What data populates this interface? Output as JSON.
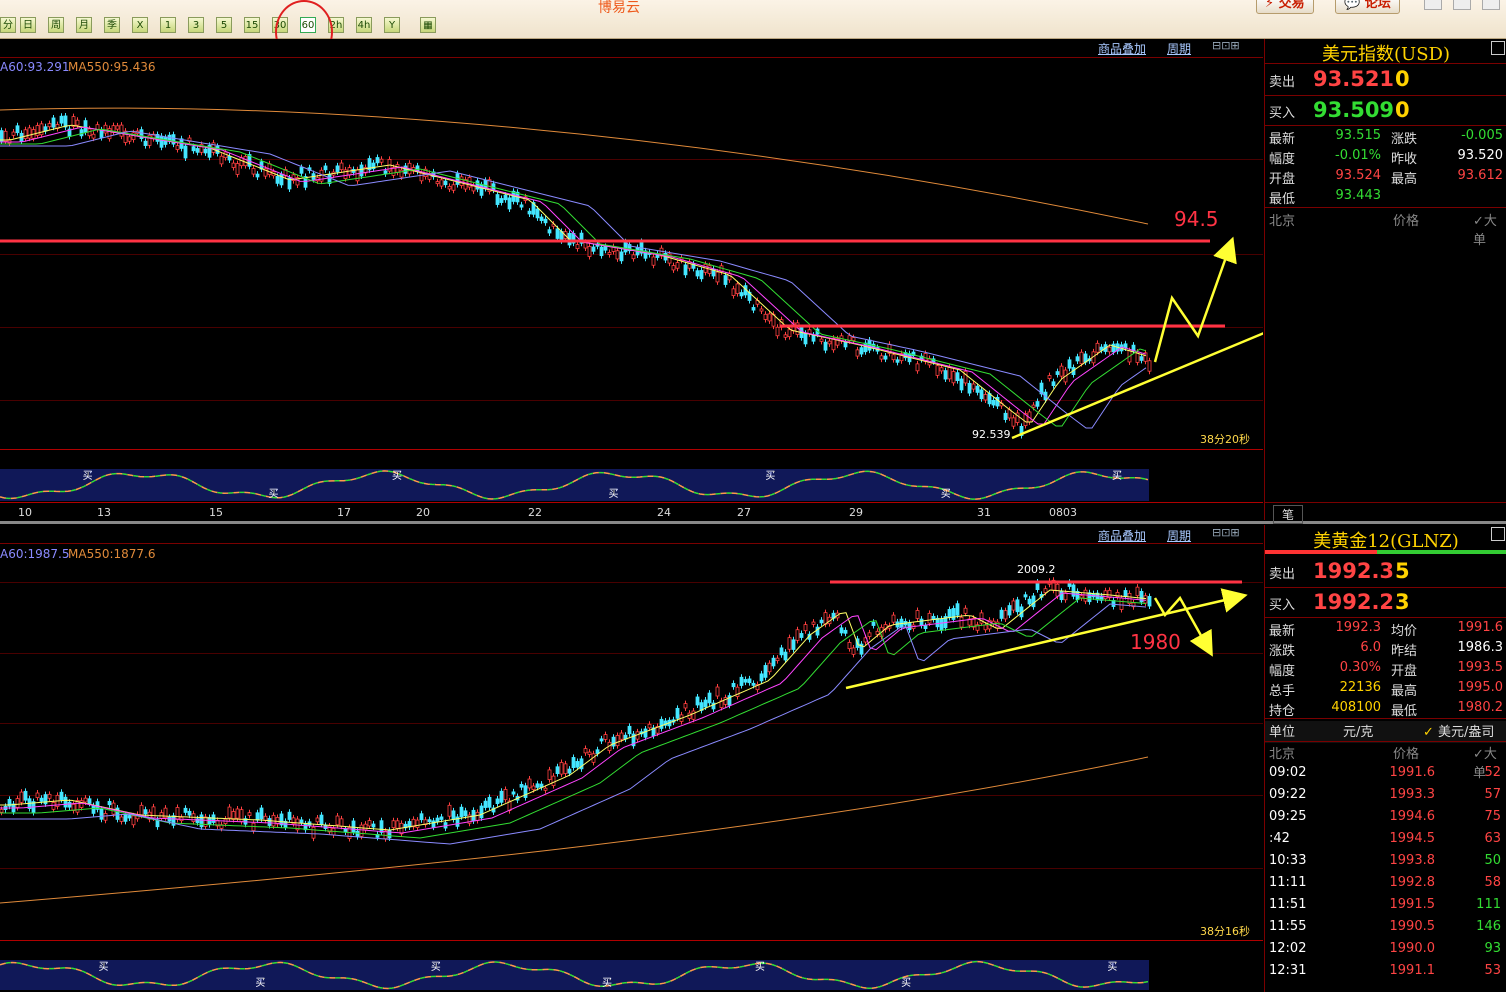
{
  "app_title": "博易云",
  "toolbar": {
    "period_buttons": [
      "分",
      "日",
      "周",
      "月",
      "季",
      "X",
      "1",
      "3",
      "5",
      "15",
      "30",
      "60",
      "2hr",
      "4hr",
      "Y",
      "▦"
    ],
    "active_period": "60",
    "trade_label": "交易",
    "forum_label": "论坛"
  },
  "top_chart": {
    "ma_labels": [
      {
        "text": "A60:93.291",
        "color": "#8a8aff"
      },
      {
        "text": "MA550:95.436",
        "color": "#e08a3a"
      }
    ],
    "overlay_link": "商品叠加",
    "period_link": "周期",
    "annotation_target": "94.5",
    "low_label": "92.539",
    "timer": "38分20秒",
    "x_ticks": [
      "10",
      "13",
      "15",
      "17",
      "20",
      "22",
      "24",
      "27",
      "29",
      "31",
      "0803"
    ],
    "indicator_marks": "买"
  },
  "bottom_chart": {
    "ma_labels": [
      {
        "text": "A60:1987.5",
        "color": "#8a8aff"
      },
      {
        "text": "MA550:1877.6",
        "color": "#e08a3a"
      }
    ],
    "overlay_link": "商品叠加",
    "period_link": "周期",
    "high_label": "2009.2",
    "annotation_target": "1980",
    "timer": "38分16秒",
    "indicator_marks": "买"
  },
  "usd_panel": {
    "title": "美元指数(USD)",
    "sell_label": "卖出",
    "sell_price": "93.521",
    "sell_vol": "0",
    "buy_label": "买入",
    "buy_price": "93.509",
    "buy_vol": "0",
    "rows": [
      {
        "k1": "最新",
        "v1": "93.515",
        "c1": "#33dd33",
        "k2": "涨跌",
        "v2": "-0.005",
        "c2": "#33dd33"
      },
      {
        "k1": "幅度",
        "v1": "-0.01%",
        "c1": "#33dd33",
        "k2": "昨收",
        "v2": "93.520",
        "c2": "#ffffff"
      },
      {
        "k1": "开盘",
        "v1": "93.524",
        "c1": "#ff4444",
        "k2": "最高",
        "v2": "93.612",
        "c2": "#ff4444"
      },
      {
        "k1": "最低",
        "v1": "93.443",
        "c1": "#33dd33",
        "k2": "",
        "v2": "",
        "c2": "#ffffff"
      }
    ],
    "tick_header": {
      "place": "北京",
      "price": "价格",
      "big": "大单"
    },
    "footer_tab": "笔"
  },
  "gold_panel": {
    "title": "美黄金12(GLNZ)",
    "sell_label": "卖出",
    "sell_price": "1992.3",
    "sell_vol": "5",
    "buy_label": "买入",
    "buy_price": "1992.2",
    "buy_vol": "3",
    "rows": [
      {
        "k1": "最新",
        "v1": "1992.3",
        "c1": "#ff4444",
        "k2": "均价",
        "v2": "1991.6",
        "c2": "#ff4444"
      },
      {
        "k1": "涨跌",
        "v1": "6.0",
        "c1": "#ff4444",
        "k2": "昨结",
        "v2": "1986.3",
        "c2": "#ffffff"
      },
      {
        "k1": "幅度",
        "v1": "0.30%",
        "c1": "#ff4444",
        "k2": "开盘",
        "v2": "1993.5",
        "c2": "#ff4444"
      },
      {
        "k1": "总手",
        "v1": "22136",
        "c1": "#ffd200",
        "k2": "最高",
        "v2": "1995.0",
        "c2": "#ff4444"
      },
      {
        "k1": "持仓",
        "v1": "408100",
        "c1": "#ffd200",
        "k2": "最低",
        "v2": "1980.2",
        "c2": "#ff4444"
      }
    ],
    "unit_label": "单位",
    "unit_cny": "元/克",
    "unit_usd": "美元/盎司",
    "tick_header": {
      "place": "北京",
      "price": "价格",
      "big": "大单"
    },
    "ticks": [
      {
        "time": "09:02",
        "price": "1991.6",
        "pc": "#ff4444",
        "vol": "52",
        "vc": "#ff4444"
      },
      {
        "time": "09:22",
        "price": "1993.3",
        "pc": "#ff4444",
        "vol": "57",
        "vc": "#ff4444"
      },
      {
        "time": "09:25",
        "price": "1994.6",
        "pc": "#ff4444",
        "vol": "75",
        "vc": "#ff4444"
      },
      {
        "time": ":42",
        "price": "1994.5",
        "pc": "#ff4444",
        "vol": "63",
        "vc": "#ff4444"
      },
      {
        "time": "10:33",
        "price": "1993.8",
        "pc": "#ff4444",
        "vol": "50",
        "vc": "#33dd33"
      },
      {
        "time": "11:11",
        "price": "1992.8",
        "pc": "#ff4444",
        "vol": "58",
        "vc": "#ff4444"
      },
      {
        "time": "11:51",
        "price": "1991.5",
        "pc": "#ff4444",
        "vol": "111",
        "vc": "#33dd33"
      },
      {
        "time": "11:55",
        "price": "1990.5",
        "pc": "#ff4444",
        "vol": "146",
        "vc": "#33dd33"
      },
      {
        "time": "12:02",
        "price": "1990.0",
        "pc": "#ff4444",
        "vol": "93",
        "vc": "#33dd33"
      },
      {
        "time": "12:31",
        "price": "1991.1",
        "pc": "#ff4444",
        "vol": "53",
        "vc": "#ff4444"
      }
    ]
  }
}
